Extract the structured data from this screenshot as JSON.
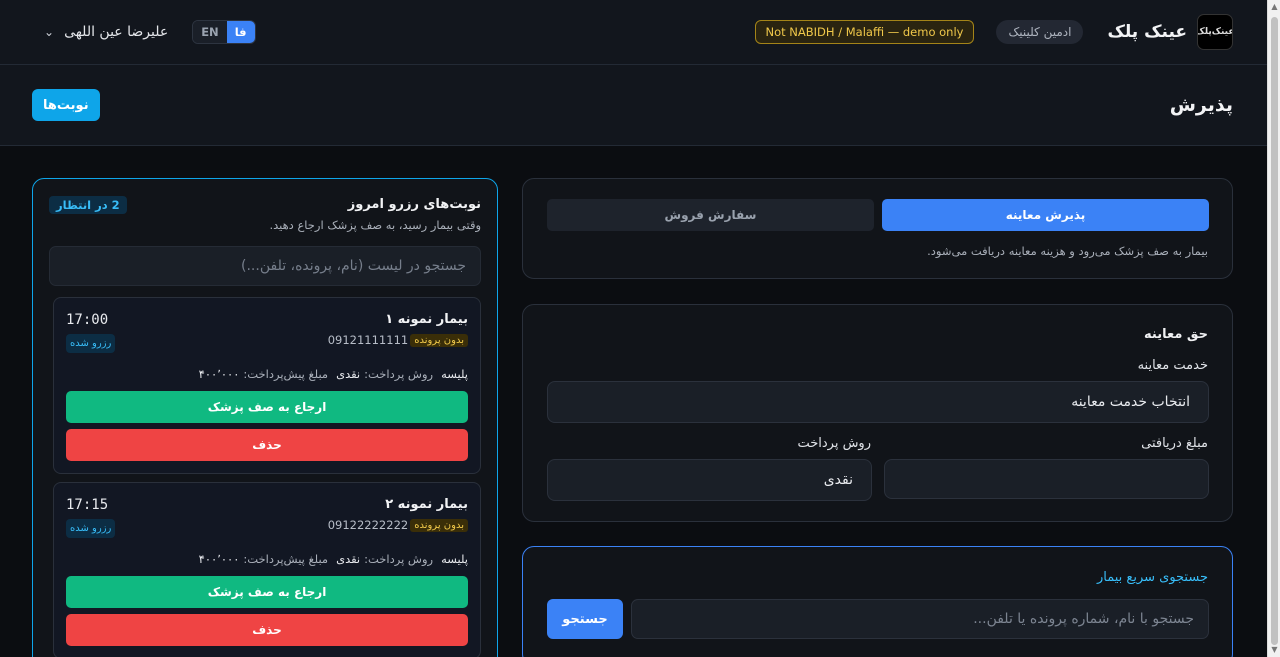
{
  "header": {
    "brand_name": "عینک پلک",
    "logo_text": "عینک‌پلک",
    "role": "ادمین کلینیک",
    "demo_notice": "Not NABIDH / Malaffi — demo only",
    "lang_en": "EN",
    "lang_fa": "فا",
    "user_name": "علیرضا عین اللهی"
  },
  "subheader": {
    "title": "پذیرش",
    "appointments_button": "نوبت‌ها"
  },
  "mode": {
    "tabs": [
      {
        "label": "پذیرش معاینه",
        "active": true
      },
      {
        "label": "سفارش فروش",
        "active": false
      }
    ],
    "description": "بیمار به صف پزشک می‌رود و هزینه معاینه دریافت می‌شود."
  },
  "fee": {
    "title": "حق معاینه",
    "service_label": "خدمت معاینه",
    "service_value": "انتخاب خدمت معاینه",
    "received_label": "مبلغ دریافتی",
    "received_value": "",
    "payment_label": "روش پرداخت",
    "payment_value": "نقدی"
  },
  "quick_search": {
    "title": "جستجوی سریع بیمار",
    "placeholder": "جستجو با نام، شماره پرونده یا تلفن...",
    "button": "جستجو"
  },
  "today_list": {
    "title": "نوبت‌های رزرو امروز",
    "subtitle": "وقتی بیمار رسید، به صف پزشک ارجاع دهید.",
    "waiting_badge": "2 در انتظار",
    "search_placeholder": "جستجو در لیست (نام، پرونده، تلفن...)",
    "appointments": [
      {
        "name": "بیمار نمونه ۱",
        "time": "17:00",
        "no_file_tag": "بدون پرونده",
        "phone": "09121111111",
        "status": "رزرو شده",
        "insurance": "پلیسه",
        "payment_method_label": "روش پرداخت:",
        "payment_method": "نقدی",
        "prepay_label": "مبلغ پیش‌پرداخت:",
        "prepay_amount": "۴۰۰٬۰۰۰",
        "refer_button": "ارجاع به صف پزشک",
        "delete_button": "حذف"
      },
      {
        "name": "بیمار نمونه ۲",
        "time": "17:15",
        "no_file_tag": "بدون پرونده",
        "phone": "09122222222",
        "status": "رزرو شده",
        "insurance": "پلیسه",
        "payment_method_label": "روش پرداخت:",
        "payment_method": "نقدی",
        "prepay_label": "مبلغ پیش‌پرداخت:",
        "prepay_amount": "۴۰۰٬۰۰۰",
        "refer_button": "ارجاع به صف پزشک",
        "delete_button": "حذف"
      }
    ]
  },
  "colors": {
    "accent": "#3b82f6",
    "sky": "#0ea5e9",
    "success": "#10b981",
    "danger": "#ef4444",
    "warning": "#f0c84a"
  }
}
